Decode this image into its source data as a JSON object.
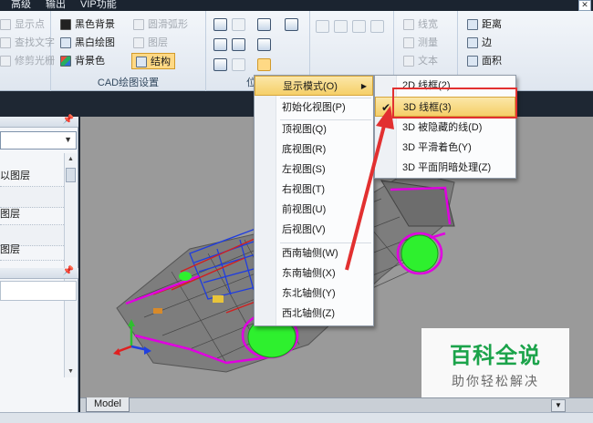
{
  "menubar": {
    "items": [
      "高级",
      "输出",
      "VIP功能"
    ],
    "close_glyph": "✕"
  },
  "ribbon": {
    "left_items": [
      "显示点",
      "查找文字",
      "修剪光栅"
    ],
    "display_settings": {
      "items": [
        {
          "label": "黑色背景",
          "icon": "black-background-icon",
          "enabled": true
        },
        {
          "label": "黑白绘图",
          "icon": "black-white-icon",
          "enabled": true
        },
        {
          "label": "背景色",
          "icon": "background-color-icon",
          "enabled": true
        },
        {
          "label": "圆滑弧形",
          "icon": "smooth-arc-icon",
          "enabled": false
        },
        {
          "label": "图层",
          "icon": "layer-icon",
          "enabled": false
        },
        {
          "label": "结构",
          "icon": "structure-icon",
          "enabled": true,
          "selected": true
        }
      ],
      "group_label": "CAD绘图设置"
    },
    "view_group_label_fragment": "位",
    "measure_group": [
      "线宽",
      "测量",
      "文本"
    ],
    "right_group": [
      "距离",
      "边",
      "面积"
    ]
  },
  "left_panel": {
    "pin_glyph": "📌",
    "layer_rows": [
      "以图层",
      "图层",
      "图层"
    ]
  },
  "display_mode_menu": {
    "title": "显示模式(O)",
    "items": [
      {
        "label": "初始化视图(P)"
      },
      {
        "label": "顶视图(Q)"
      },
      {
        "label": "底视图(R)"
      },
      {
        "label": "左视图(S)"
      },
      {
        "label": "右视图(T)"
      },
      {
        "label": "前视图(U)"
      },
      {
        "label": "后视图(V)"
      },
      {
        "label": "西南轴侧(W)"
      },
      {
        "label": "东南轴侧(X)"
      },
      {
        "label": "东北轴侧(Y)"
      },
      {
        "label": "西北轴侧(Z)"
      }
    ]
  },
  "submenu": {
    "items": [
      {
        "label": "2D 线框(2)",
        "checked": false
      },
      {
        "label": "3D 线框(3)",
        "checked": true
      },
      {
        "label": "3D 被隐藏的线(D)",
        "checked": false
      },
      {
        "label": "3D 平滑着色(Y)",
        "checked": false
      },
      {
        "label": "3D 平面阴暗处理(Z)",
        "checked": false
      }
    ],
    "check_glyph": "✔"
  },
  "viewport": {
    "tab_label": "Model"
  },
  "watermark": {
    "big": "百科全说",
    "small": "助你轻松解决"
  },
  "colors": {
    "highlight": "#f5cf68",
    "annotation_red": "#e23030",
    "viewport_bg": "#9a9a9a",
    "watermark_green": "#1ba34a"
  }
}
